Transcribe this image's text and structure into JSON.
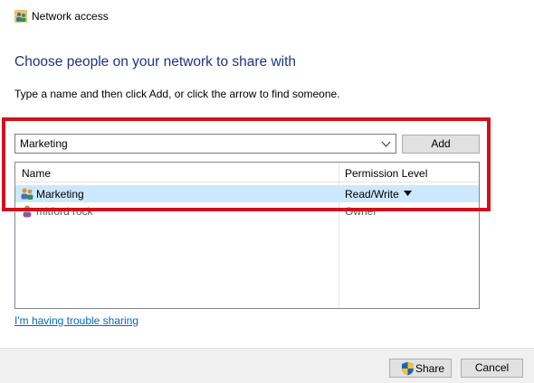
{
  "window": {
    "title": "Network access",
    "icon": "network-users-icon"
  },
  "main": {
    "heading": "Choose people on your network to share with",
    "instruction": "Type a name and then click Add, or click the arrow to find someone.",
    "name_input_value": "Marketing",
    "add_label": "Add"
  },
  "list": {
    "columns": [
      "Name",
      "Permission Level"
    ],
    "rows": [
      {
        "name": "Marketing",
        "permission": "Read/Write",
        "icon": "group-users-icon",
        "selected": true
      },
      {
        "name": "mitford rock",
        "permission": "Owner",
        "icon": "user-icon",
        "selected": false
      }
    ]
  },
  "links": {
    "trouble": "I'm having trouble sharing"
  },
  "footer": {
    "share_label": "Share",
    "cancel_label": "Cancel"
  },
  "colors": {
    "heading": "#1e3287",
    "highlight_box": "#d0121b",
    "selected_row": "#cce8ff",
    "link": "#0066cc"
  }
}
